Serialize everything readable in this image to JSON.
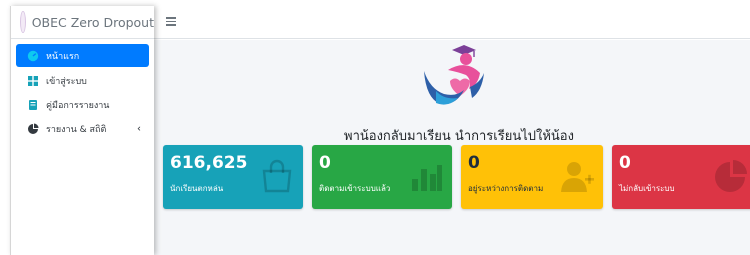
{
  "brand": {
    "title": "OBEC Zero Dropout"
  },
  "sidebar": {
    "items": [
      {
        "label": "หน้าแรก",
        "icon": "gauge-icon",
        "active": true
      },
      {
        "label": "เข้าสู่ระบบ",
        "icon": "grid-icon",
        "active": false
      },
      {
        "label": "คู่มือการรายงาน",
        "icon": "book-icon",
        "active": false
      },
      {
        "label": "รายงาน & สถิติ",
        "icon": "pie-chart-icon",
        "active": false,
        "has_submenu": true
      }
    ]
  },
  "header": {
    "menu_icon": "hamburger-icon"
  },
  "main": {
    "slogan": "พาน้องกลับมาเรียน นำการเรียนไปให้น้อง",
    "stats": [
      {
        "value": "616,625",
        "label": "นักเรียนตกหล่น",
        "color": "#17a2b8",
        "icon": "shopping-bag-icon"
      },
      {
        "value": "0",
        "label": "ติดตามเข้าระบบแล้ว",
        "color": "#28a745",
        "icon": "bar-chart-icon"
      },
      {
        "value": "0",
        "label": "อยู่ระหว่างการติดตาม",
        "color": "#ffc107",
        "icon": "user-plus-icon"
      },
      {
        "value": "0",
        "label": "ไม่กลับเข้าระบบ",
        "color": "#dc3545",
        "icon": "pie-chart-icon"
      }
    ]
  },
  "colors": {
    "primary": "#007bff",
    "content_bg": "#f4f6f9"
  }
}
